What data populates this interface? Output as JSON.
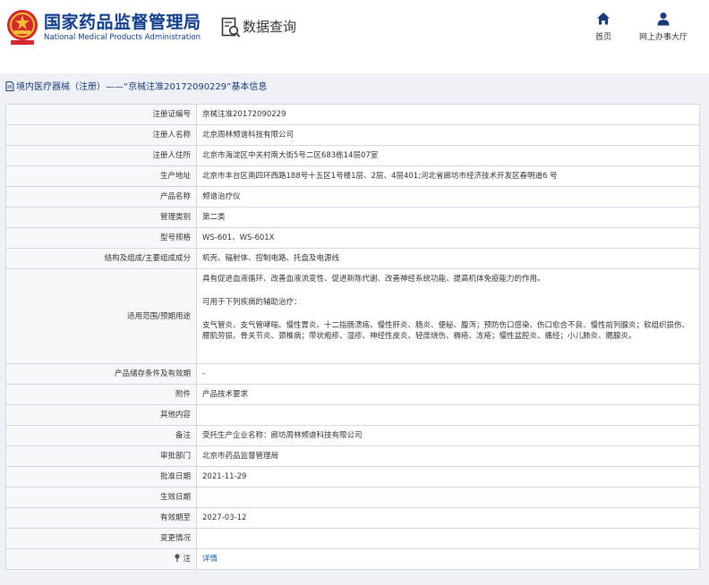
{
  "header": {
    "title": "国家药品监督管理局",
    "subtitle": "National Medical Products Administration",
    "section": "数据查询",
    "nav": [
      {
        "label": "首页",
        "icon": "home-icon"
      },
      {
        "label": "网上办事大厅",
        "icon": "user-icon"
      }
    ]
  },
  "breadcrumb": "境内医疗器械（注册）——“京械注准20172090229”基本信息",
  "colors": {
    "brand": "#0f3d8c",
    "panel": "#eef2f7",
    "border": "#cfd7e2",
    "link": "#1a5fb4"
  },
  "rows": [
    {
      "key": "注册证编号",
      "value": "京械注准20172090229"
    },
    {
      "key": "注册人名称",
      "value": "北京周林频谱科技有限公司"
    },
    {
      "key": "注册人住所",
      "value": "北京市海淀区中关村南大街5号二区683栋14层07室"
    },
    {
      "key": "生产地址",
      "value": "北京市丰台区南四环西路188号十五区1号楼1层、2层、4层401;河北省廊坊市经济技术开发区春明道6 号"
    },
    {
      "key": "产品名称",
      "value": "频谱治疗仪"
    },
    {
      "key": "管理类别",
      "value": "第二类"
    },
    {
      "key": "型号规格",
      "value": "WS-601、WS-601X"
    },
    {
      "key": "结构及组成/主要组成成分",
      "value": "机壳、辐射体、控制电路、托盘及电源线"
    },
    {
      "key": "适用范围/预期用途",
      "value_lines": [
        "具有促进血液循环、改善血液流变性、促进新陈代谢、改善神经系统功能、提高机体免疫能力的作用。",
        "可用于下列疾病的辅助治疗：",
        "支气管炎、支气管哮喘、慢性胃炎、十二指肠溃疡、慢性肝炎、肠炎、便秘、腹泻；预防伤口感染、伤口愈合不良、慢性前列腺炎；软组织损伤、腰肌劳损、骨关节炎、颈椎病；带状疱疹、湿疹、神经性皮炎、轻度烧伤、褥疮、冻疮；慢性盆腔炎、痛经；小儿肺炎、腮腺炎。"
      ]
    },
    {
      "key": "产品储存条件及有效期",
      "value": "-"
    },
    {
      "key": "附件",
      "value": "产品技术要求"
    },
    {
      "key": "其他内容",
      "value": ""
    },
    {
      "key": "备注",
      "value": "受托生产企业名称：廊坊周林频谱科技有限公司"
    },
    {
      "key": "审批部门",
      "value": "北京市药品监督管理局"
    },
    {
      "key": "批准日期",
      "value": "2021-11-29"
    },
    {
      "key": "生效日期",
      "value": ""
    },
    {
      "key": "有效期至",
      "value": "2027-03-12"
    },
    {
      "key": "变更情况",
      "value": ""
    },
    {
      "key": "注",
      "value": "详情",
      "key_icon": "pin-icon"
    }
  ]
}
